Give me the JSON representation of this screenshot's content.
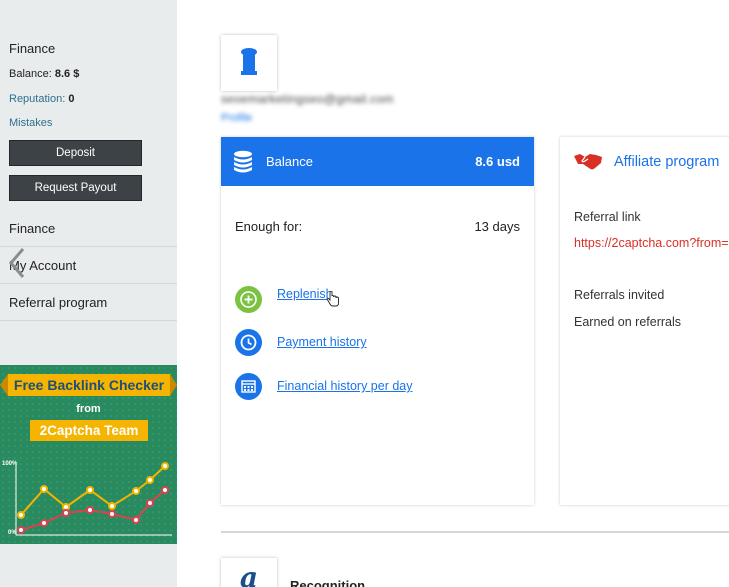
{
  "sidebar": {
    "title": "Finance",
    "balance_label": "Balance:",
    "balance_value": "8.6 $",
    "reputation_label": "Reputation:",
    "reputation_value": "0",
    "mistakes_label": "Mistakes",
    "deposit_label": "Deposit",
    "payout_label": "Request Payout",
    "nav": [
      "Finance",
      "My Account",
      "Referral program"
    ]
  },
  "banner": {
    "title": "Free Backlink Checker",
    "from": "from",
    "brand": "2Captcha Team",
    "label_top": "100%",
    "label_bottom": "0%"
  },
  "profile": {
    "email": "seoemarketingseo@gmail.com",
    "edit_label": "Profile"
  },
  "balance": {
    "title": "Balance",
    "value": "8.6 usd",
    "enough_label": "Enough for:",
    "enough_value": "13 days",
    "actions": [
      "Replenish",
      "Payment history",
      "Financial history per day"
    ]
  },
  "affiliate": {
    "title": "Affiliate program",
    "referral_link_label": "Referral link",
    "referral_link": "https://2captcha.com?from=",
    "invited_label": "Referrals invited",
    "earned_label": "Earned on referrals"
  },
  "recognition": {
    "title": "Recognition",
    "icon_letter": "a"
  },
  "colors": {
    "accent": "#1a73e8",
    "sidebar_bg": "#e9ecec",
    "button_dark": "#3c4246",
    "link_red": "#d93025",
    "replenish_green": "#7cc242"
  }
}
